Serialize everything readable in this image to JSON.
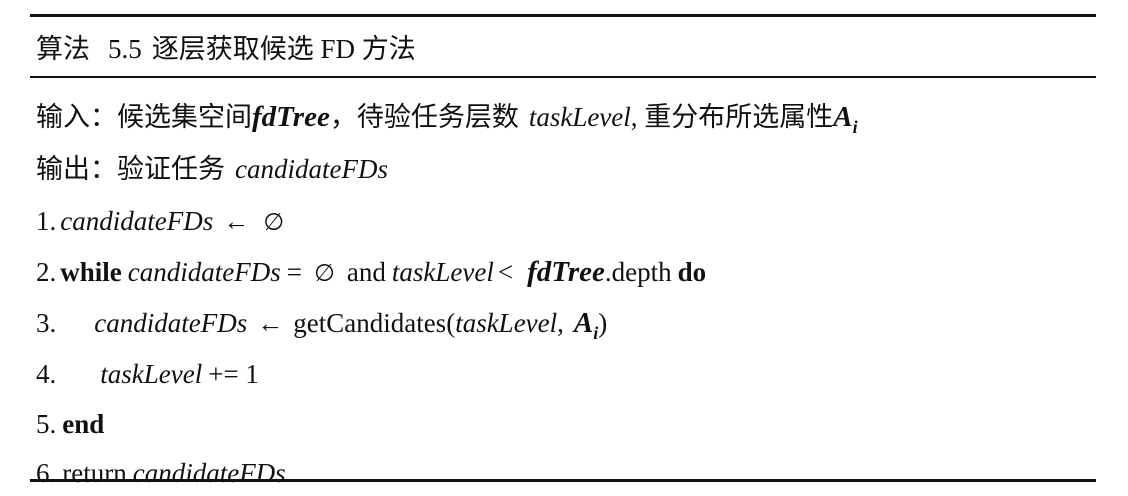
{
  "title": {
    "prefix": "算法",
    "number": "5.5",
    "text": "逐层获取候选 FD 方法"
  },
  "input": {
    "label": "输入：",
    "desc1": "候选集空间",
    "var1": "fdTree",
    "sep1": "，待验任务层数",
    "var2": "taskLevel",
    "sep2": ", 重分布所选属性",
    "var3": "A",
    "var3_sub": "i"
  },
  "output": {
    "label": "输出：",
    "desc": "验证任务",
    "var": "candidateFDs"
  },
  "steps": [
    {
      "num": "1.",
      "var": "candidateFDs",
      "arrow": "←",
      "value": "∅"
    },
    {
      "num": "2.",
      "kw_while": "while",
      "var": "candidateFDs",
      "eq": "=",
      "value": "∅",
      "and": "and",
      "var2": "taskLevel",
      "lt": "<",
      "var3": "fdTree",
      "depth": ".depth",
      "kw_do": "do"
    },
    {
      "num": "3.",
      "var": "candidateFDs",
      "arrow": "←",
      "call": "getCandidates(",
      "arg1": "taskLevel",
      "comma": ",",
      "arg2": "A",
      "arg2_sub": "i",
      "close": ")"
    },
    {
      "num": "4.",
      "var": "taskLevel",
      "op": "+= 1"
    },
    {
      "num": "5.",
      "kw_end": "end"
    },
    {
      "num": "6.",
      "ret": "return",
      "var": "candidateFDs"
    }
  ]
}
